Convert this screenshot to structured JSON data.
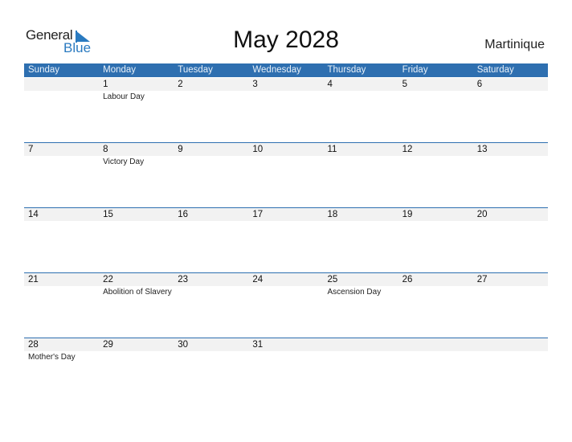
{
  "logo": {
    "general": "General",
    "blue": "Blue",
    "icon": "flag-triangle-icon",
    "accent": "#2a7ac0"
  },
  "title": "May 2028",
  "country": "Martinique",
  "colors": {
    "header_bg": "#2e6fb0",
    "date_strip": "#f2f2f2"
  },
  "days_of_week": [
    "Sunday",
    "Monday",
    "Tuesday",
    "Wednesday",
    "Thursday",
    "Friday",
    "Saturday"
  ],
  "weeks": [
    [
      {
        "day": "",
        "holiday": ""
      },
      {
        "day": "1",
        "holiday": "Labour Day"
      },
      {
        "day": "2",
        "holiday": ""
      },
      {
        "day": "3",
        "holiday": ""
      },
      {
        "day": "4",
        "holiday": ""
      },
      {
        "day": "5",
        "holiday": ""
      },
      {
        "day": "6",
        "holiday": ""
      }
    ],
    [
      {
        "day": "7",
        "holiday": ""
      },
      {
        "day": "8",
        "holiday": "Victory Day"
      },
      {
        "day": "9",
        "holiday": ""
      },
      {
        "day": "10",
        "holiday": ""
      },
      {
        "day": "11",
        "holiday": ""
      },
      {
        "day": "12",
        "holiday": ""
      },
      {
        "day": "13",
        "holiday": ""
      }
    ],
    [
      {
        "day": "14",
        "holiday": ""
      },
      {
        "day": "15",
        "holiday": ""
      },
      {
        "day": "16",
        "holiday": ""
      },
      {
        "day": "17",
        "holiday": ""
      },
      {
        "day": "18",
        "holiday": ""
      },
      {
        "day": "19",
        "holiday": ""
      },
      {
        "day": "20",
        "holiday": ""
      }
    ],
    [
      {
        "day": "21",
        "holiday": ""
      },
      {
        "day": "22",
        "holiday": "Abolition of Slavery"
      },
      {
        "day": "23",
        "holiday": ""
      },
      {
        "day": "24",
        "holiday": ""
      },
      {
        "day": "25",
        "holiday": "Ascension Day"
      },
      {
        "day": "26",
        "holiday": ""
      },
      {
        "day": "27",
        "holiday": ""
      }
    ],
    [
      {
        "day": "28",
        "holiday": "Mother's Day"
      },
      {
        "day": "29",
        "holiday": ""
      },
      {
        "day": "30",
        "holiday": ""
      },
      {
        "day": "31",
        "holiday": ""
      },
      {
        "day": "",
        "holiday": ""
      },
      {
        "day": "",
        "holiday": ""
      },
      {
        "day": "",
        "holiday": ""
      }
    ]
  ]
}
